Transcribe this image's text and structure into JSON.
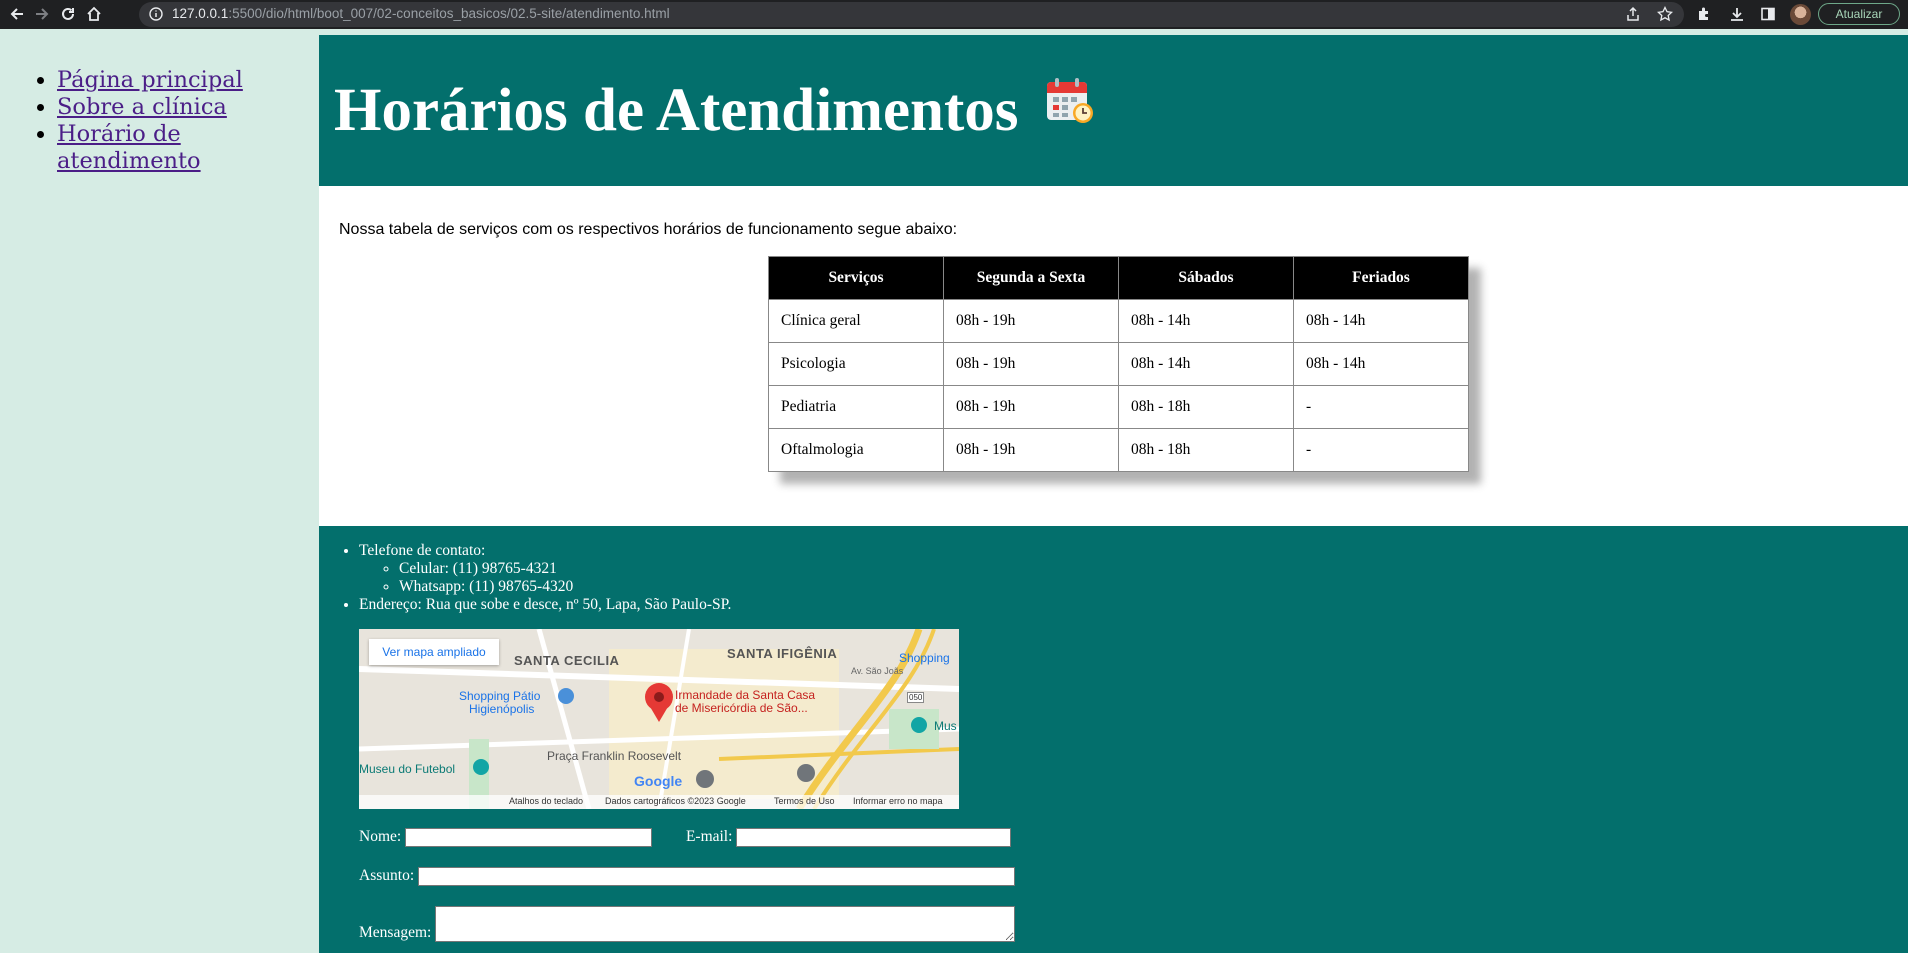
{
  "browser": {
    "url_host": "127.0.0.1",
    "url_path": ":5500/dio/html/boot_007/02-conceitos_basicos/02.5-site/atendimento.html",
    "update_label": "Atualizar"
  },
  "sidebar": {
    "items": [
      {
        "label": "Página principal"
      },
      {
        "label": "Sobre a clínica"
      },
      {
        "label": "Horário de atendimento"
      }
    ]
  },
  "header": {
    "title": "Horários de Atendimentos"
  },
  "main": {
    "intro": "Nossa tabela de serviços com os respectivos horários de funcionamento segue abaixo:",
    "table": {
      "headers": [
        "Serviços",
        "Segunda a Sexta",
        "Sábados",
        "Feriados"
      ],
      "rows": [
        [
          "Clínica geral",
          "08h - 19h",
          "08h - 14h",
          "08h - 14h"
        ],
        [
          "Psicologia",
          "08h - 19h",
          "08h - 14h",
          "08h - 14h"
        ],
        [
          "Pediatria",
          "08h - 19h",
          "08h - 18h",
          "-"
        ],
        [
          "Oftalmologia",
          "08h - 19h",
          "08h - 18h",
          "-"
        ]
      ]
    }
  },
  "footer": {
    "phone_label": "Telefone de contato:",
    "cell": "Celular: (11) 98765-4321",
    "whatsapp": "Whatsapp: (11) 98765-4320",
    "address": "Endereço: Rua que sobe e desce, nº 50, Lapa, São Paulo-SP.",
    "map": {
      "button": "Ver mapa ampliado",
      "labels": {
        "santa_cecilia": "SANTA CECILIA",
        "santa_ifigenia": "SANTA IFIGÊNIA",
        "shopping_patio": "Shopping Pátio",
        "higienopolis": "Higienópolis",
        "irmandade1": "Irmandade da Santa Casa",
        "irmandade2": "de Misericórdia de São...",
        "praca": "Praça Franklin Roosevelt",
        "museu": "Museu do Futebol",
        "shopping": "Shopping",
        "mus": "Mus",
        "av": "Av. São Joãs",
        "road": "050",
        "google": "Google"
      },
      "footer": {
        "shortcuts": "Atalhos do teclado",
        "data": "Dados cartográficos ©2023 Google",
        "terms": "Termos de Uso",
        "report": "Informar erro no mapa"
      }
    },
    "form": {
      "name_label": "Nome:",
      "email_label": "E-mail:",
      "subject_label": "Assunto:",
      "message_label": "Mensagem:"
    }
  },
  "colors": {
    "sidebar_bg": "#d6ece4",
    "header_bg": "#036f6c",
    "table_header_bg": "#000000"
  }
}
